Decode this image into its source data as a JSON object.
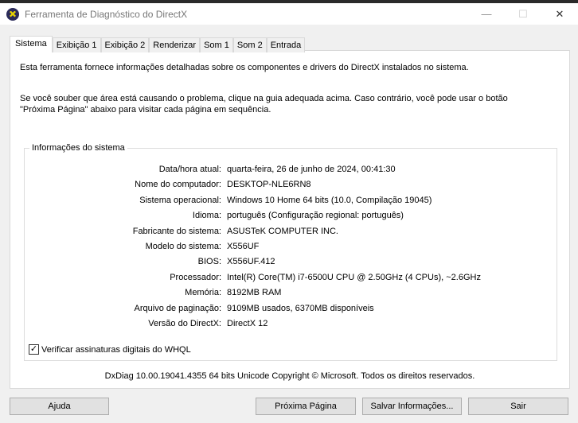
{
  "window": {
    "title": "Ferramenta de Diagnóstico do DirectX",
    "minimize": "—",
    "maximize": "☐",
    "close": "✕"
  },
  "tabs": [
    "Sistema",
    "Exibição 1",
    "Exibição 2",
    "Renderizar",
    "Som 1",
    "Som 2",
    "Entrada"
  ],
  "intro1": "Esta ferramenta fornece informações detalhadas sobre os componentes e drivers do DirectX instalados no sistema.",
  "intro2": "Se você souber que área está causando o problema, clique na guia adequada acima. Caso contrário, você pode usar o botão \"Próxima Página\" abaixo para visitar cada página em sequência.",
  "group": {
    "title": "Informações do sistema",
    "rows": [
      {
        "label": "Data/hora atual:",
        "value": "quarta-feira, 26 de junho de 2024, 00:41:30"
      },
      {
        "label": "Nome do computador:",
        "value": "DESKTOP-NLE6RN8"
      },
      {
        "label": "Sistema operacional:",
        "value": "Windows 10 Home 64 bits (10.0, Compilação 19045)"
      },
      {
        "label": "Idioma:",
        "value": "português (Configuração regional: português)"
      },
      {
        "label": "Fabricante do sistema:",
        "value": "ASUSTeK COMPUTER INC."
      },
      {
        "label": "Modelo do sistema:",
        "value": "X556UF"
      },
      {
        "label": "BIOS:",
        "value": "X556UF.412"
      },
      {
        "label": "Processador:",
        "value": "Intel(R) Core(TM) i7-6500U CPU @ 2.50GHz (4 CPUs), ~2.6GHz"
      },
      {
        "label": "Memória:",
        "value": "8192MB RAM"
      },
      {
        "label": "Arquivo de paginação:",
        "value": "9109MB usados, 6370MB disponíveis"
      },
      {
        "label": "Versão do DirectX:",
        "value": "DirectX 12"
      }
    ]
  },
  "whql": {
    "label": "Verificar assinaturas digitais do WHQL",
    "checked": true,
    "mark": "✓"
  },
  "footer": "DxDiag 10.00.19041.4355 64 bits Unicode  Copyright © Microsoft. Todos os direitos reservados.",
  "buttons": {
    "help": "Ajuda",
    "next": "Próxima Página",
    "save": "Salvar Informações...",
    "exit": "Sair"
  }
}
